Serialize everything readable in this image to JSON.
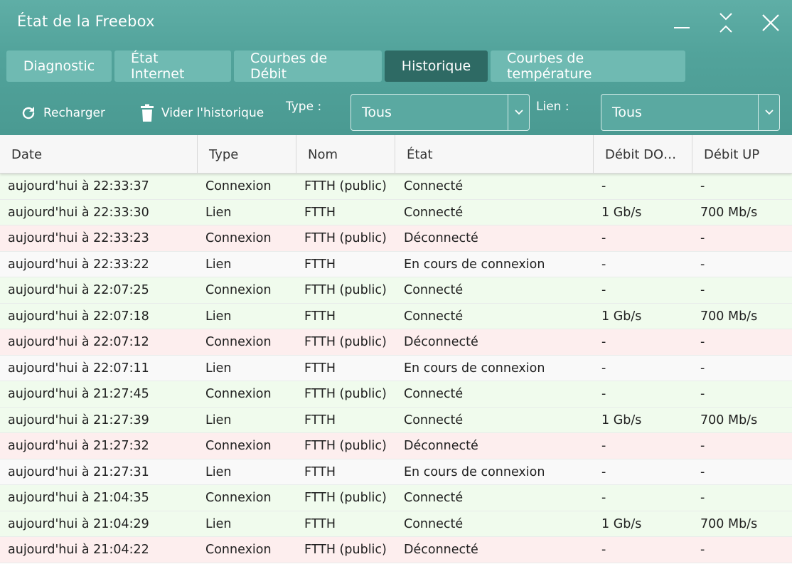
{
  "window": {
    "title": "État de la Freebox",
    "accent_color": "#52a39b",
    "active_tab_color": "#2e6a64"
  },
  "tabs": [
    {
      "label": "Diagnostic",
      "active": false
    },
    {
      "label": "État Internet",
      "active": false
    },
    {
      "label": "Courbes de Débit",
      "active": false
    },
    {
      "label": "Historique",
      "active": true
    },
    {
      "label": "Courbes de température",
      "active": false
    }
  ],
  "toolbar": {
    "reload_label": "Recharger",
    "reload_icon": "refresh-icon",
    "clear_label": "Vider l'historique",
    "clear_icon": "trash-icon",
    "type_label": "Type :",
    "type_value": "Tous",
    "lien_label": "Lien :",
    "lien_value": "Tous"
  },
  "table": {
    "columns": [
      "Date",
      "Type",
      "Nom",
      "État",
      "Débit DO…",
      "Débit UP"
    ],
    "rows": [
      {
        "status": "ok",
        "cells": [
          "aujourd'hui à 22:33:37",
          "Connexion",
          "FTTH (public)",
          "Connecté",
          "-",
          "-"
        ]
      },
      {
        "status": "ok",
        "cells": [
          "aujourd'hui à 22:33:30",
          "Lien",
          "FTTH",
          "Connecté",
          "1 Gb/s",
          "700 Mb/s"
        ]
      },
      {
        "status": "ko",
        "cells": [
          "aujourd'hui à 22:33:23",
          "Connexion",
          "FTTH (public)",
          "Déconnecté",
          "-",
          "-"
        ]
      },
      {
        "status": "pending",
        "cells": [
          "aujourd'hui à 22:33:22",
          "Lien",
          "FTTH",
          "En cours de connexion",
          "-",
          "-"
        ]
      },
      {
        "status": "ok",
        "cells": [
          "aujourd'hui à 22:07:25",
          "Connexion",
          "FTTH (public)",
          "Connecté",
          "-",
          "-"
        ]
      },
      {
        "status": "ok",
        "cells": [
          "aujourd'hui à 22:07:18",
          "Lien",
          "FTTH",
          "Connecté",
          "1 Gb/s",
          "700 Mb/s"
        ]
      },
      {
        "status": "ko",
        "cells": [
          "aujourd'hui à 22:07:12",
          "Connexion",
          "FTTH (public)",
          "Déconnecté",
          "-",
          "-"
        ]
      },
      {
        "status": "pending",
        "cells": [
          "aujourd'hui à 22:07:11",
          "Lien",
          "FTTH",
          "En cours de connexion",
          "-",
          "-"
        ]
      },
      {
        "status": "ok",
        "cells": [
          "aujourd'hui à 21:27:45",
          "Connexion",
          "FTTH (public)",
          "Connecté",
          "-",
          "-"
        ]
      },
      {
        "status": "ok",
        "cells": [
          "aujourd'hui à 21:27:39",
          "Lien",
          "FTTH",
          "Connecté",
          "1 Gb/s",
          "700 Mb/s"
        ]
      },
      {
        "status": "ko",
        "cells": [
          "aujourd'hui à 21:27:32",
          "Connexion",
          "FTTH (public)",
          "Déconnecté",
          "-",
          "-"
        ]
      },
      {
        "status": "pending",
        "cells": [
          "aujourd'hui à 21:27:31",
          "Lien",
          "FTTH",
          "En cours de connexion",
          "-",
          "-"
        ]
      },
      {
        "status": "ok",
        "cells": [
          "aujourd'hui à 21:04:35",
          "Connexion",
          "FTTH (public)",
          "Connecté",
          "-",
          "-"
        ]
      },
      {
        "status": "ok",
        "cells": [
          "aujourd'hui à 21:04:29",
          "Lien",
          "FTTH",
          "Connecté",
          "1 Gb/s",
          "700 Mb/s"
        ]
      },
      {
        "status": "ko",
        "cells": [
          "aujourd'hui à 21:04:22",
          "Connexion",
          "FTTH (public)",
          "Déconnecté",
          "-",
          "-"
        ]
      }
    ]
  }
}
